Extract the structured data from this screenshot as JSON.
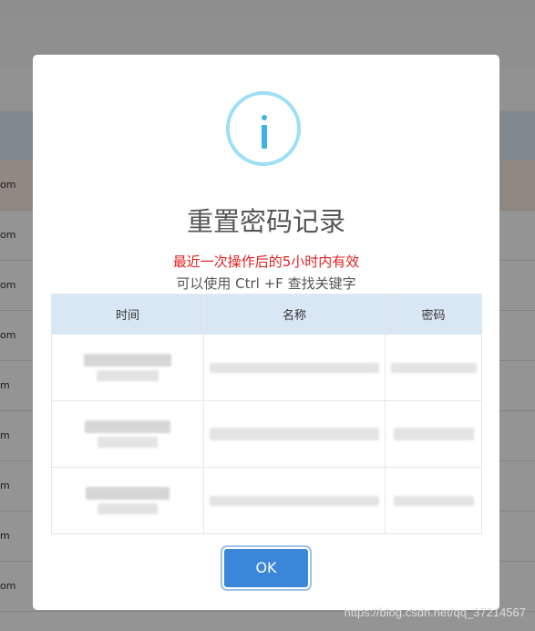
{
  "background": {
    "rows": [
      "om",
      "om",
      "om",
      "om",
      "m",
      "m",
      "m",
      "m",
      "om"
    ]
  },
  "dialog": {
    "icon": "info-icon",
    "title": "重置密码记录",
    "notice": "最近一次操作后的5小时内有效",
    "hint": "可以使用 Ctrl +F 查找关键字",
    "table": {
      "headers": [
        "时间",
        "名称",
        "密码"
      ]
    },
    "ok_label": "OK"
  },
  "watermark": "https://blog.csdn.net/qq_37214567",
  "colors": {
    "accent": "#3a86d8",
    "notice": "#e02020",
    "icon": "#3db3e3",
    "header_bg": "#d9e7f4"
  }
}
